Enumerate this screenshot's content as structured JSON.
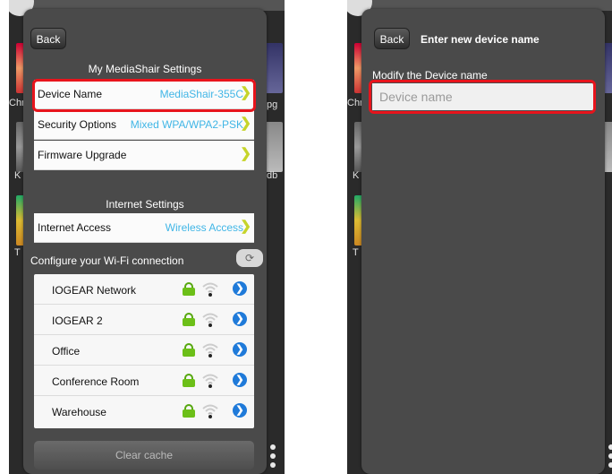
{
  "left_screen": {
    "back_label": "Back",
    "settings_title": "My MediaShair Settings",
    "device_settings": [
      {
        "label": "Device Name",
        "value": "MediaShair-355C"
      },
      {
        "label": "Security Options",
        "value": "Mixed WPA/WPA2-PSK"
      },
      {
        "label": "Firmware Upgrade",
        "value": ""
      }
    ],
    "internet_title": "Internet Settings",
    "internet_access": {
      "label": "Internet Access",
      "value": "Wireless Access"
    },
    "wifi_heading": "Configure your Wi-Fi connection",
    "refresh_icon": "refresh-icon",
    "networks": [
      {
        "name": "IOGEAR Network",
        "locked": true
      },
      {
        "name": "IOGEAR 2",
        "locked": true
      },
      {
        "name": "Office",
        "locked": true
      },
      {
        "name": "Conference Room",
        "locked": true
      },
      {
        "name": "Warehouse",
        "locked": true
      }
    ],
    "clear_cache_label": "Clear cache",
    "background_labels": [
      "Chr",
      "pg",
      "K",
      "db",
      "T"
    ]
  },
  "right_screen": {
    "back_label": "Back",
    "title": "Enter new device name",
    "field_label": "Modify the Device name",
    "input_placeholder": "Device name",
    "background_labels": [
      "Chr",
      "K",
      "T"
    ]
  },
  "colors": {
    "accent_value": "#41b6e6",
    "chevron": "#c6d42a",
    "highlight": "#e8141c",
    "lock": "#6cbf18",
    "arrow_button": "#1f7ad9",
    "dialog_bg": "#4a4a4a"
  }
}
